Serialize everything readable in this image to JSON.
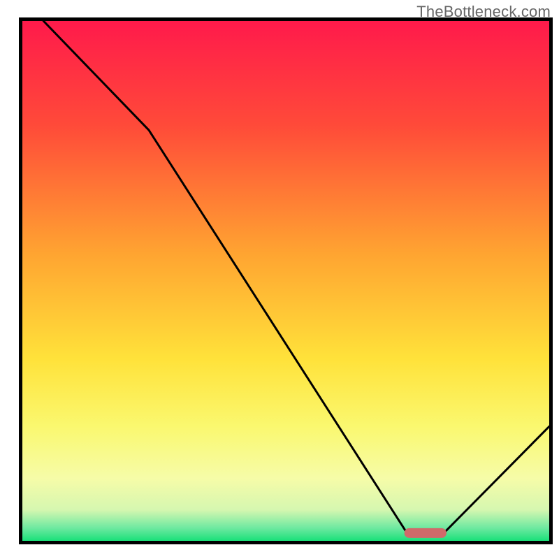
{
  "watermark": "TheBottleneck.com",
  "chart_data": {
    "type": "line",
    "title": "",
    "xlabel": "",
    "ylabel": "",
    "xlim": [
      0,
      100
    ],
    "ylim": [
      0,
      100
    ],
    "gradient_stops": [
      {
        "offset": 0,
        "color": "#ff1a4b"
      },
      {
        "offset": 0.2,
        "color": "#ff4a39"
      },
      {
        "offset": 0.45,
        "color": "#ffa531"
      },
      {
        "offset": 0.65,
        "color": "#ffe23a"
      },
      {
        "offset": 0.78,
        "color": "#faf86f"
      },
      {
        "offset": 0.88,
        "color": "#f6fca8"
      },
      {
        "offset": 0.94,
        "color": "#d6f7b0"
      },
      {
        "offset": 0.975,
        "color": "#6fe9a1"
      },
      {
        "offset": 1.0,
        "color": "#19e079"
      }
    ],
    "series": [
      {
        "name": "bottleneck-curve",
        "x": [
          4,
          24,
          73,
          80,
          100
        ],
        "y": [
          100,
          79,
          1.5,
          1.5,
          22
        ]
      }
    ],
    "marker": {
      "name": "optimal-zone",
      "x_center": 76.5,
      "y": 1.5,
      "width_x": 8,
      "color": "#d06a6a"
    },
    "colors": {
      "curve": "#000000",
      "axis": "#000000",
      "bg": "#ffffff"
    }
  }
}
